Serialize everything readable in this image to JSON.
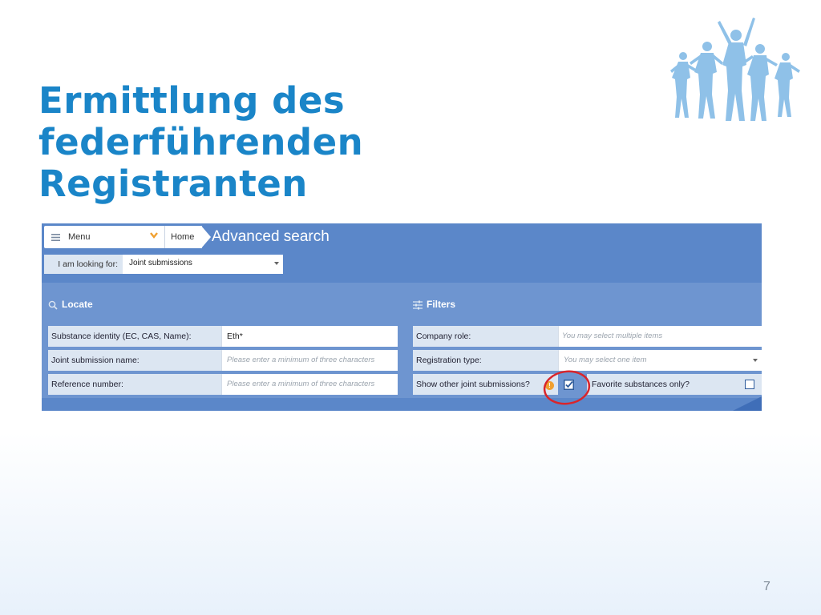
{
  "slide": {
    "title_line1": "Ermittlung des federführenden",
    "title_line2": "Registranten",
    "page_number": "7",
    "title_color": "#1a85c8"
  },
  "logo": {
    "name": "running-people-logo",
    "color": "#8fc1e8"
  },
  "app": {
    "menu_label": "Menu",
    "home_label": "Home",
    "page_title": "Advanced search",
    "looking_for_label": "I am looking for:",
    "looking_for_value": "Joint submissions",
    "accent_color": "#5b87c9"
  },
  "locate": {
    "heading": "Locate",
    "fields": [
      {
        "label": "Substance identity (EC, CAS, Name):",
        "value": "Eth*",
        "placeholder": ""
      },
      {
        "label": "Joint submission name:",
        "value": "",
        "placeholder": "Please enter a minimum of three characters"
      },
      {
        "label": "Reference number:",
        "value": "",
        "placeholder": "Please enter a minimum of three characters"
      }
    ]
  },
  "filters": {
    "heading": "Filters",
    "company_role": {
      "label": "Company role:",
      "placeholder": "You may select multiple items"
    },
    "registration_type": {
      "label": "Registration type:",
      "placeholder": "You may select one item"
    },
    "show_other": {
      "label": "Show other joint submissions?",
      "checked": true,
      "info_icon": "!"
    },
    "favorite_only": {
      "label": "Favorite substances only?",
      "checked": false
    }
  }
}
